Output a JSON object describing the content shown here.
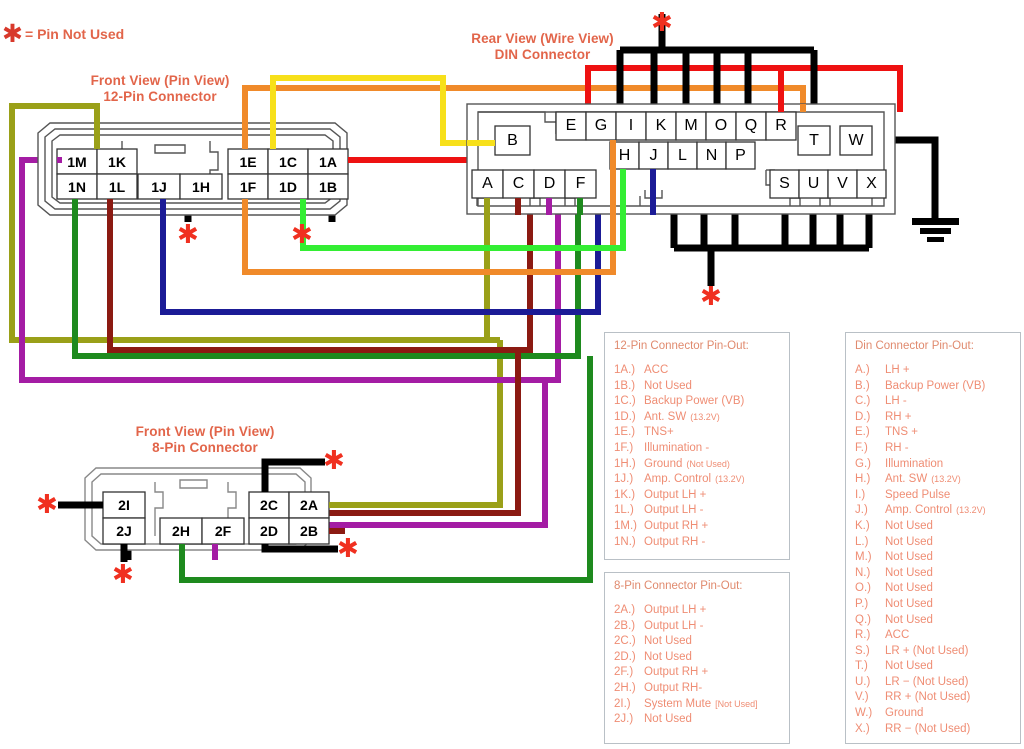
{
  "key": {
    "symbol": "✱",
    "text": "= Pin Not Used"
  },
  "titles": {
    "twelve_pin": {
      "line1": "Front View (Pin View)",
      "line2": "12-Pin Connector"
    },
    "din": {
      "line1": "Rear View (Wire View)",
      "line2": "DIN Connector"
    },
    "eight_pin": {
      "line1": "Front View (Pin View)",
      "line2": "8-Pin Connector"
    }
  },
  "connectors": {
    "twelve_pin": {
      "group_left": [
        [
          "1M",
          "1K"
        ],
        [
          "1N",
          "1L"
        ]
      ],
      "group_mid": [
        [
          "1J",
          "1H"
        ]
      ],
      "group_right": [
        [
          "1E",
          "1C",
          "1A"
        ],
        [
          "1F",
          "1D",
          "1B"
        ]
      ]
    },
    "eight_pin": {
      "group_left": [
        [
          "2I"
        ],
        [
          "2J"
        ]
      ],
      "group_mid": [
        [
          "2H",
          "2F"
        ]
      ],
      "group_right": [
        [
          "2C",
          "2A"
        ],
        [
          "2D",
          "2B"
        ]
      ]
    },
    "din": {
      "row_b": [
        "B"
      ],
      "row_top": [
        "E",
        "G",
        "I",
        "K",
        "M",
        "O",
        "Q",
        "R"
      ],
      "row_t": [
        "T",
        "W"
      ],
      "row_mid": [
        "H",
        "J",
        "L",
        "N",
        "P"
      ],
      "row_bottom_left": [
        "A",
        "C",
        "D",
        "F"
      ],
      "row_bottom_right": [
        "S",
        "U",
        "V",
        "X"
      ]
    }
  },
  "legends": {
    "twelve_pin": {
      "header": "12-Pin Connector Pin-Out:",
      "rows": [
        {
          "k": "1A.)",
          "v": "ACC",
          "sm": ""
        },
        {
          "k": "1B.)",
          "v": "Not Used",
          "sm": ""
        },
        {
          "k": "1C.)",
          "v": "Backup Power (VB)",
          "sm": ""
        },
        {
          "k": "1D.)",
          "v": "Ant. SW",
          "sm": "(13.2V)"
        },
        {
          "k": "1E.)",
          "v": "TNS+",
          "sm": ""
        },
        {
          "k": "1F.)",
          "v": "Illumination -",
          "sm": ""
        },
        {
          "k": "1H.)",
          "v": "Ground",
          "sm": "(Not Used)"
        },
        {
          "k": "1J.)",
          "v": "Amp. Control",
          "sm": "(13.2V)"
        },
        {
          "k": "1K.)",
          "v": "Output LH +",
          "sm": ""
        },
        {
          "k": "1L.)",
          "v": "Output LH -",
          "sm": ""
        },
        {
          "k": "1M.)",
          "v": "Output RH +",
          "sm": ""
        },
        {
          "k": "1N.)",
          "v": "Output RH -",
          "sm": ""
        }
      ]
    },
    "eight_pin": {
      "header": "8-Pin Connector Pin-Out:",
      "rows": [
        {
          "k": "2A.)",
          "v": "Output LH +",
          "sm": ""
        },
        {
          "k": "2B.)",
          "v": "Output LH -",
          "sm": ""
        },
        {
          "k": "2C.)",
          "v": "Not Used",
          "sm": ""
        },
        {
          "k": "2D.)",
          "v": "Not Used",
          "sm": ""
        },
        {
          "k": "2F.)",
          "v": "Output RH +",
          "sm": ""
        },
        {
          "k": "2H.)",
          "v": "Output RH-",
          "sm": ""
        },
        {
          "k": "2I.)",
          "v": "System Mute",
          "sm": "[Not Used]"
        },
        {
          "k": "2J.)",
          "v": "Not Used",
          "sm": ""
        }
      ]
    },
    "din": {
      "header": "Din Connector Pin-Out:",
      "rows": [
        {
          "k": "A.)",
          "v": "LH +",
          "sm": ""
        },
        {
          "k": "B.)",
          "v": "Backup Power (VB)",
          "sm": ""
        },
        {
          "k": "C.)",
          "v": "LH -",
          "sm": ""
        },
        {
          "k": "D.)",
          "v": "RH +",
          "sm": ""
        },
        {
          "k": "E.)",
          "v": "TNS +",
          "sm": ""
        },
        {
          "k": "F.)",
          "v": "RH -",
          "sm": ""
        },
        {
          "k": "G.)",
          "v": "Illumination",
          "sm": ""
        },
        {
          "k": "H.)",
          "v": "Ant. SW",
          "sm": "(13.2V)"
        },
        {
          "k": "I.)",
          "v": "Speed Pulse",
          "sm": ""
        },
        {
          "k": "J.)",
          "v": "Amp. Control",
          "sm": "(13.2V)"
        },
        {
          "k": "K.)",
          "v": "Not Used",
          "sm": ""
        },
        {
          "k": "L.)",
          "v": "Not Used",
          "sm": ""
        },
        {
          "k": "M.)",
          "v": "Not Used",
          "sm": ""
        },
        {
          "k": "N.)",
          "v": "Not Used",
          "sm": ""
        },
        {
          "k": "O.)",
          "v": "Not Used",
          "sm": ""
        },
        {
          "k": "P.)",
          "v": "Not Used",
          "sm": ""
        },
        {
          "k": "Q.)",
          "v": "Not Used",
          "sm": ""
        },
        {
          "k": "R.)",
          "v": "ACC",
          "sm": ""
        },
        {
          "k": "S.)",
          "v": "LR + (Not Used)",
          "sm": ""
        },
        {
          "k": "T.)",
          "v": "Not Used",
          "sm": ""
        },
        {
          "k": "U.)",
          "v": "LR − (Not Used)",
          "sm": ""
        },
        {
          "k": "V.)",
          "v": "RR + (Not Used)",
          "sm": ""
        },
        {
          "k": "W.)",
          "v": "Ground",
          "sm": ""
        },
        {
          "k": "X.)",
          "v": "RR − (Not Used)",
          "sm": ""
        }
      ]
    }
  },
  "wire_colors": {
    "olive": "#9aa018",
    "purple": "#a41ca4",
    "dark_green": "#1e8a1e",
    "dark_red": "#8b1a12",
    "navy": "#1b1b96",
    "black": "#000000",
    "orange": "#f08a2a",
    "bright_green": "#33ee33",
    "yellow": "#f7e01a",
    "red": "#ee1111",
    "magenta": "#a41ca4",
    "ground_black": "#000000"
  },
  "accent_colors": {
    "title_text": "#e2654a",
    "legend_text": "#ef8d74",
    "legend_border": "#b9c0c6",
    "asterisk": "#f03020",
    "housing_outline": "#555555",
    "pin_border": "#333333"
  }
}
